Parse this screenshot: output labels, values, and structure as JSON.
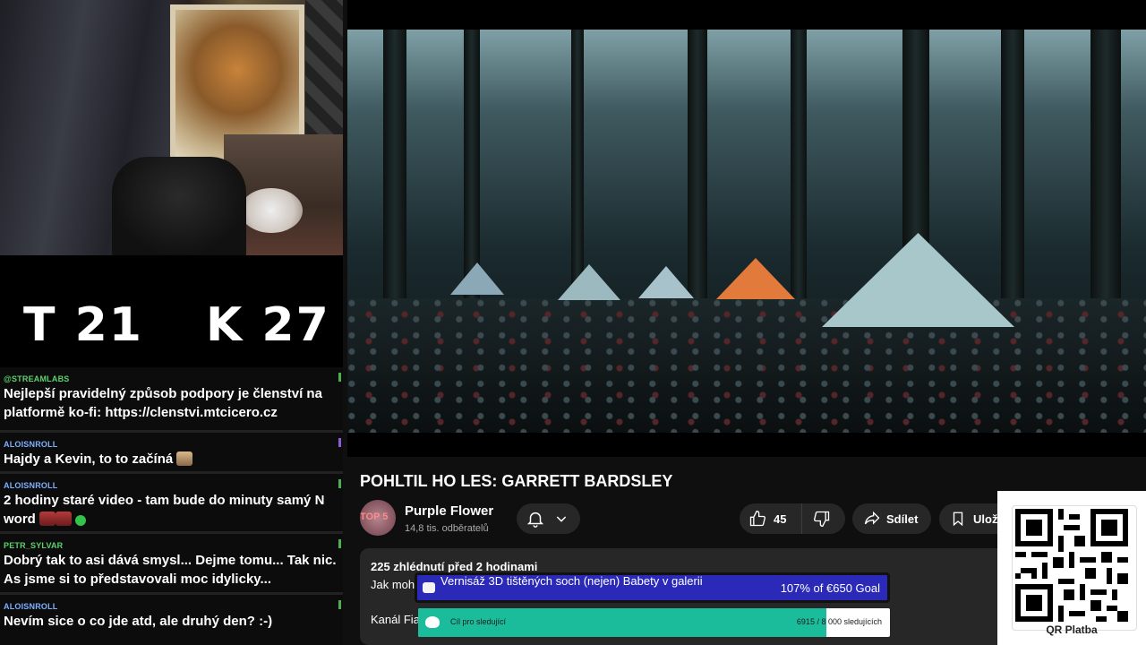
{
  "score": {
    "t_label": "T 21",
    "k_label": "K 27"
  },
  "chat": {
    "messages": [
      {
        "author": "@STREAMLABS",
        "text": "Nejlepší pravidelný způsob podpory je členství na platformě ko-fi: https://clenstvi.mtcicero.cz"
      },
      {
        "author": "ALOISNROLL",
        "text": "Hajdy a Kevin, to to začíná"
      },
      {
        "author": "ALOISNROLL",
        "text": "2 hodiny staré video - tam bude do minuty samý N word"
      },
      {
        "author": "PETR_SYLVAR",
        "text": "Dobrý tak to asi dává smysl... Dejme tomu... Tak nic. As jsme si to představovali moc idylicky..."
      },
      {
        "author": "ALOISNROLL",
        "text": "Nevím sice o co jde atd, ale druhý den? :-)"
      }
    ]
  },
  "video": {
    "title": "POHLTIL HO LES: GARRETT BARDSLEY",
    "channel": {
      "name": "Purple Flower",
      "subscribers": "14,8 tis. odběratelů",
      "avatar_text": "TOP 5"
    },
    "likes": "45",
    "share_label": "Sdílet",
    "save_label": "Ulož",
    "description": {
      "meta": "225 zhlédnutí  před 2 hodinami",
      "line1": "Jak moh",
      "line2": "Kanál Fia"
    }
  },
  "goal": {
    "title": "Vernisáž 3D tištěných soch (nejen) Babety v galerii",
    "amount": "107% of €650 Goal",
    "color": "#2b2ab8"
  },
  "follower_goal": {
    "label": "Cíl pro sledující",
    "count": "6915 / 8 000 sledujících",
    "progress": 0.865,
    "color": "#1abc9c"
  },
  "qr": {
    "caption": "QR Platba"
  },
  "icons": [
    "bell-icon",
    "chevron-down-icon",
    "thumbs-up-icon",
    "thumbs-down-icon",
    "share-icon",
    "save-icon",
    "qr-code-icon"
  ]
}
